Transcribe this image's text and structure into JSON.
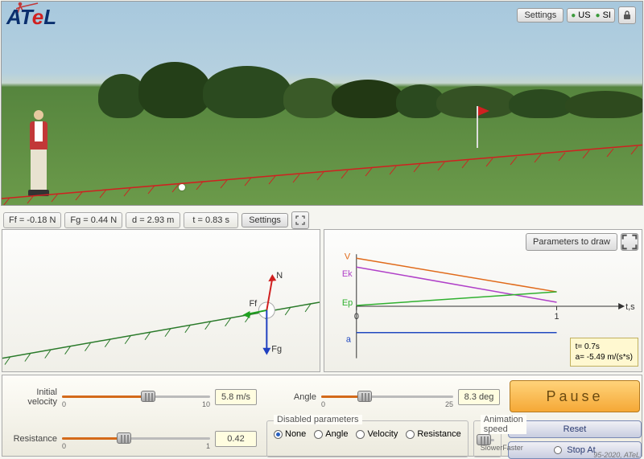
{
  "app": {
    "logo_parts": [
      "A",
      "T",
      "e",
      "L"
    ],
    "copyright": "95-2020, ATeL"
  },
  "toolbar": {
    "settings_label": "Settings",
    "unit_us": "US",
    "unit_si": "SI"
  },
  "readouts": {
    "ff": "Ff = -0.18 N",
    "fg": "Fg = 0.44 N",
    "d": "d = 2.93 m",
    "t": "t = 0.83 s",
    "settings_label": "Settings"
  },
  "diagram": {
    "labels": {
      "N": "N",
      "Ff": "Ff",
      "Fg": "Fg"
    }
  },
  "chart_data": {
    "type": "line",
    "xlabel": "t,s",
    "ylabel": "",
    "x_ticks": [
      0,
      1
    ],
    "x_range": [
      0,
      1.3
    ],
    "series": [
      {
        "name": "V",
        "label": "V",
        "color": "#e06a1a",
        "points": [
          [
            0,
            1.0
          ],
          [
            1,
            0.3
          ]
        ]
      },
      {
        "name": "Ek",
        "label": "Ek",
        "color": "#b040c8",
        "points": [
          [
            0,
            0.82
          ],
          [
            1,
            0.08
          ]
        ]
      },
      {
        "name": "Ep",
        "label": "Ep",
        "color": "#30b030",
        "points": [
          [
            0,
            0.02
          ],
          [
            1,
            0.3
          ]
        ]
      },
      {
        "name": "a",
        "label": "a",
        "color": "#2048c0",
        "points": [
          [
            0,
            -0.55
          ],
          [
            1,
            -0.55
          ]
        ]
      }
    ],
    "tooltip": {
      "t": "t= 0.7s",
      "a": "a= -5.49 m/(s*s)"
    },
    "params_button": "Parameters to draw"
  },
  "controls": {
    "initial_velocity": {
      "label": "Initial\nvelocity",
      "min": 0,
      "max": 10,
      "value": 5.8,
      "display": "5.8 m/s"
    },
    "angle": {
      "label": "Angle",
      "min": 0,
      "max": 25,
      "value": 8.3,
      "display": "8.3 deg"
    },
    "resistance": {
      "label": "Resistance",
      "min": 0,
      "max": 1,
      "value": 0.42,
      "display": "0.42"
    },
    "disabled_group": {
      "title": "Disabled parameters",
      "options": [
        "None",
        "Angle",
        "Velocity",
        "Resistance"
      ],
      "selected": "None"
    },
    "anim_speed": {
      "title": "Animation speed",
      "low": "Slower",
      "high": "Faster",
      "value": 0.25
    },
    "pause": "Pause",
    "reset": "Reset",
    "stopat": "Stop At"
  }
}
